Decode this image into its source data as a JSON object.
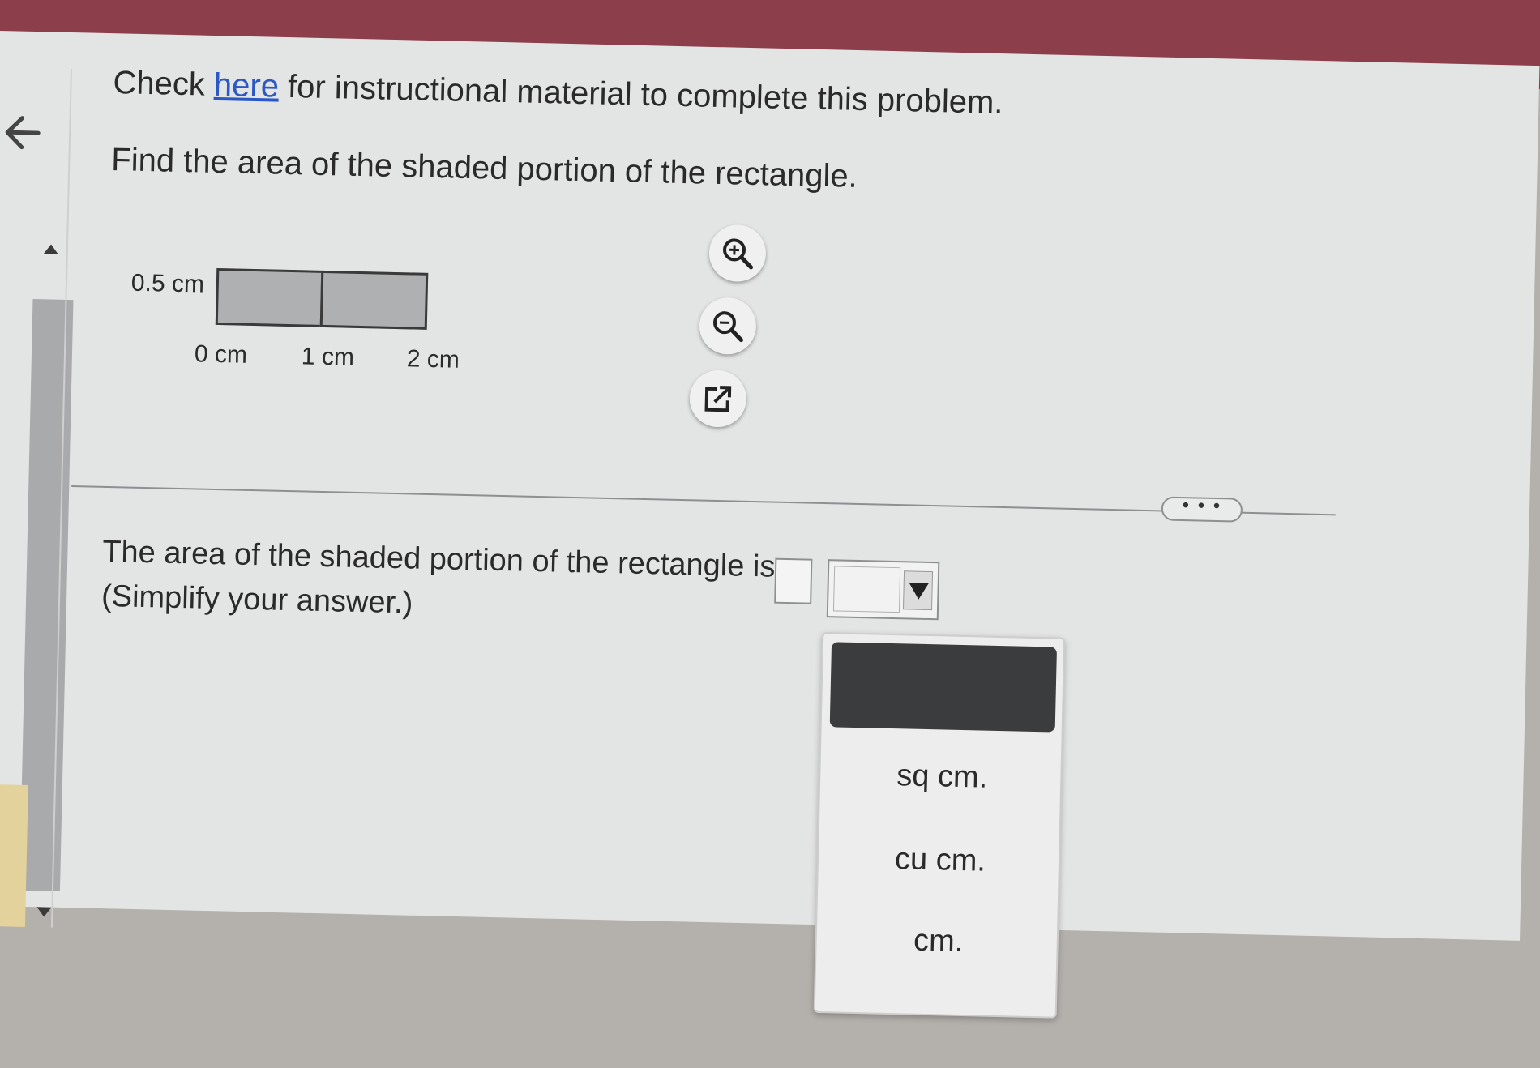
{
  "header": {
    "prefix": "Check ",
    "link_label": "here",
    "suffix": " for instructional material to complete this problem."
  },
  "question": "Find the area of the shaded portion of the rectangle.",
  "figure": {
    "height_label": "0.5 cm",
    "ticks": [
      "0 cm",
      "1 cm",
      "2 cm"
    ],
    "shade_color": "#aeb0b2"
  },
  "tools": {
    "zoom_in": "zoom-in-icon",
    "zoom_out": "zoom-out-icon",
    "popout": "external-link-icon"
  },
  "more_button": "• • •",
  "answer": {
    "sentence": "The area of the shaded portion of the rectangle is",
    "hint": "(Simplify your answer.)",
    "input_value": "",
    "unit_value": ""
  },
  "unit_options": [
    "",
    "sq cm.",
    "cu cm.",
    "cm."
  ],
  "colors": {
    "link": "#2b58c4",
    "top_bar": "#8c3e4b",
    "panel": "#e3e4e4"
  }
}
